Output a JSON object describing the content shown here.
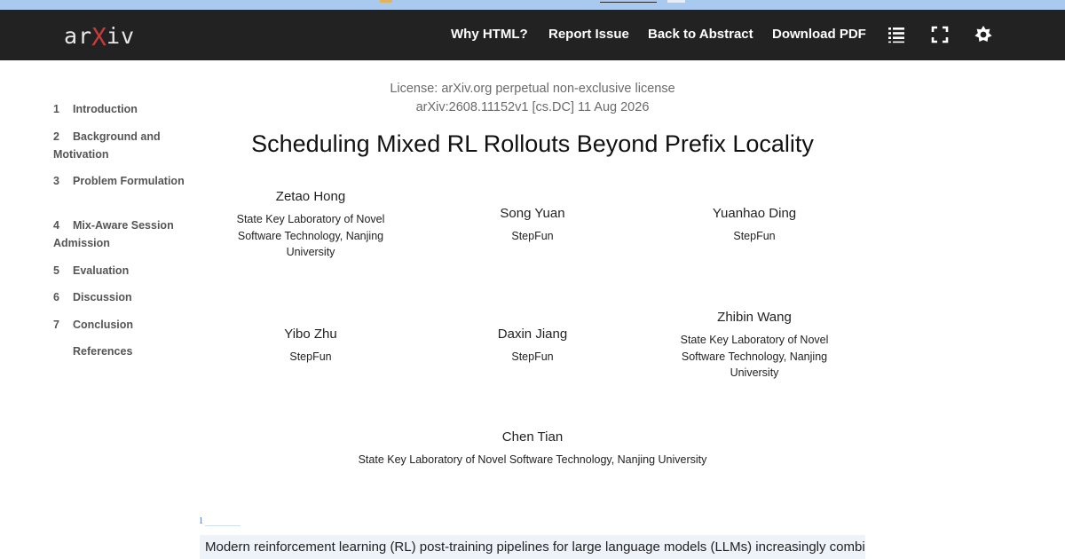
{
  "header": {
    "logo": {
      "prefix": "ar",
      "x": "X",
      "suffix": "iv"
    },
    "nav": [
      "Why HTML?",
      "Report Issue",
      "Back to Abstract",
      "Download PDF"
    ],
    "icons": [
      "toc-list-icon",
      "fullscreen-icon",
      "theme-toggle-icon"
    ]
  },
  "toc": [
    {
      "num": "1",
      "label": "Introduction"
    },
    {
      "num": "2",
      "label": "Background and Motivation"
    },
    {
      "num": "3",
      "label": "Problem Formulation"
    },
    {
      "num": "4",
      "label": "Mix-Aware Session Admission"
    },
    {
      "num": "5",
      "label": "Evaluation"
    },
    {
      "num": "6",
      "label": "Discussion"
    },
    {
      "num": "7",
      "label": "Conclusion"
    },
    {
      "num": "",
      "label": "References"
    }
  ],
  "paper": {
    "license": "License: arXiv.org perpetual non-exclusive license",
    "id_line": "arXiv:2608.11152v1 [cs.DC] 11 Aug 2026",
    "title": "Scheduling Mixed RL Rollouts Beyond Prefix Locality",
    "authors": [
      {
        "name": "Zetao Hong",
        "affiliation": "State Key Laboratory of Novel Software Technology, Nanjing University"
      },
      {
        "name": "Song Yuan",
        "affiliation": "StepFun"
      },
      {
        "name": "Yuanhao Ding",
        "affiliation": "StepFun"
      },
      {
        "name": "Yibo Zhu",
        "affiliation": "StepFun"
      },
      {
        "name": "Daxin Jiang",
        "affiliation": "StepFun"
      },
      {
        "name": "Zhibin Wang",
        "affiliation": "State Key Laboratory of Novel Software Technology, Nanjing University"
      },
      {
        "name": "Chen Tian",
        "affiliation": "State Key Laboratory of Novel Software Technology, Nanjing University"
      }
    ],
    "footnote_mark": "1",
    "abstract_start": "Modern reinforcement learning (RL) post-training pipelines for large language models (LLMs) increasingly combine"
  },
  "colors": {
    "header_bg": "#222222",
    "logo_x": "#c63b3b",
    "top_strip": "#a9c9ee",
    "abstract_highlight": "#eef3fa"
  }
}
